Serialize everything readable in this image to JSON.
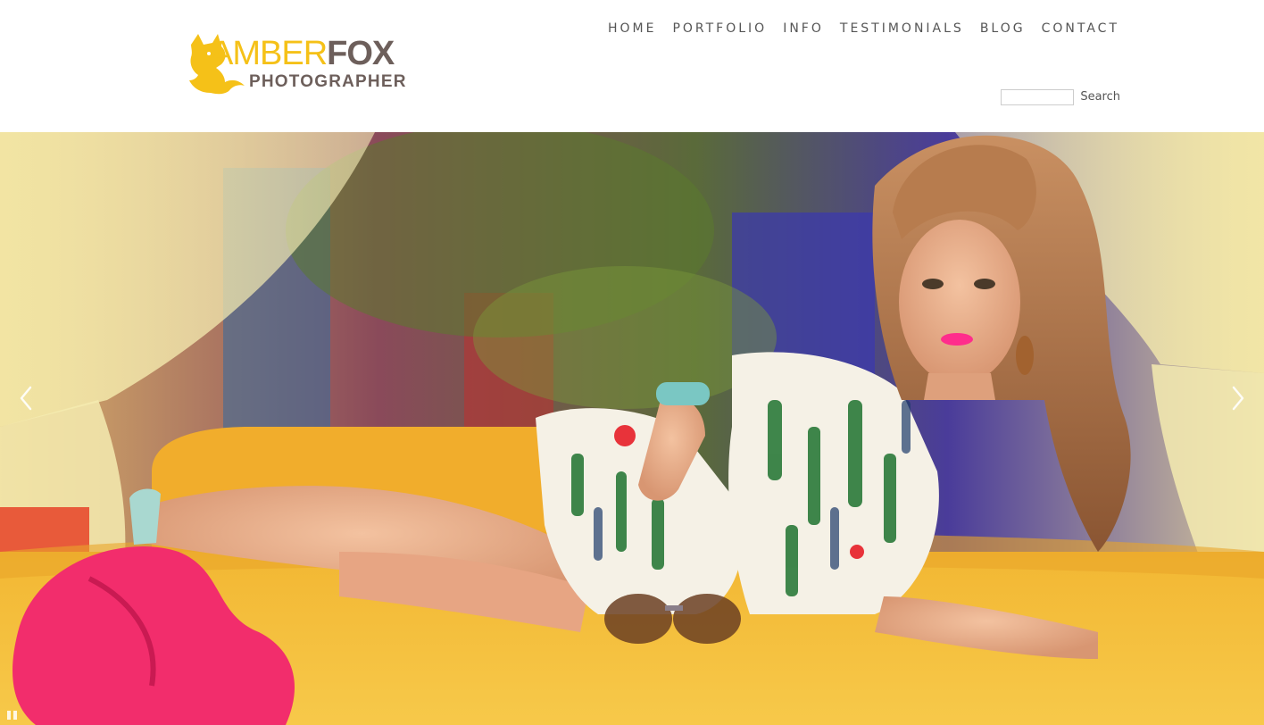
{
  "brand": {
    "name_part1": "AMBER",
    "name_part2": "FOX",
    "tagline": "PHOTOGRAPHER",
    "primary_color": "#f5c118",
    "secondary_color": "#6d5f5b",
    "logo_icon": "fox-icon"
  },
  "nav": {
    "items": [
      {
        "label": "HOME"
      },
      {
        "label": "PORTFOLIO"
      },
      {
        "label": "INFO"
      },
      {
        "label": "TESTIMONIALS"
      },
      {
        "label": "BLOG"
      },
      {
        "label": "CONTACT"
      }
    ],
    "text_color": "#555555"
  },
  "search": {
    "value": "",
    "placeholder": "",
    "button_label": "Search"
  },
  "slideshow": {
    "prev_icon": "chevron-left-icon",
    "next_icon": "chevron-right-icon",
    "pause_icon": "pause-icon",
    "photo_subject": "hero-photo"
  }
}
